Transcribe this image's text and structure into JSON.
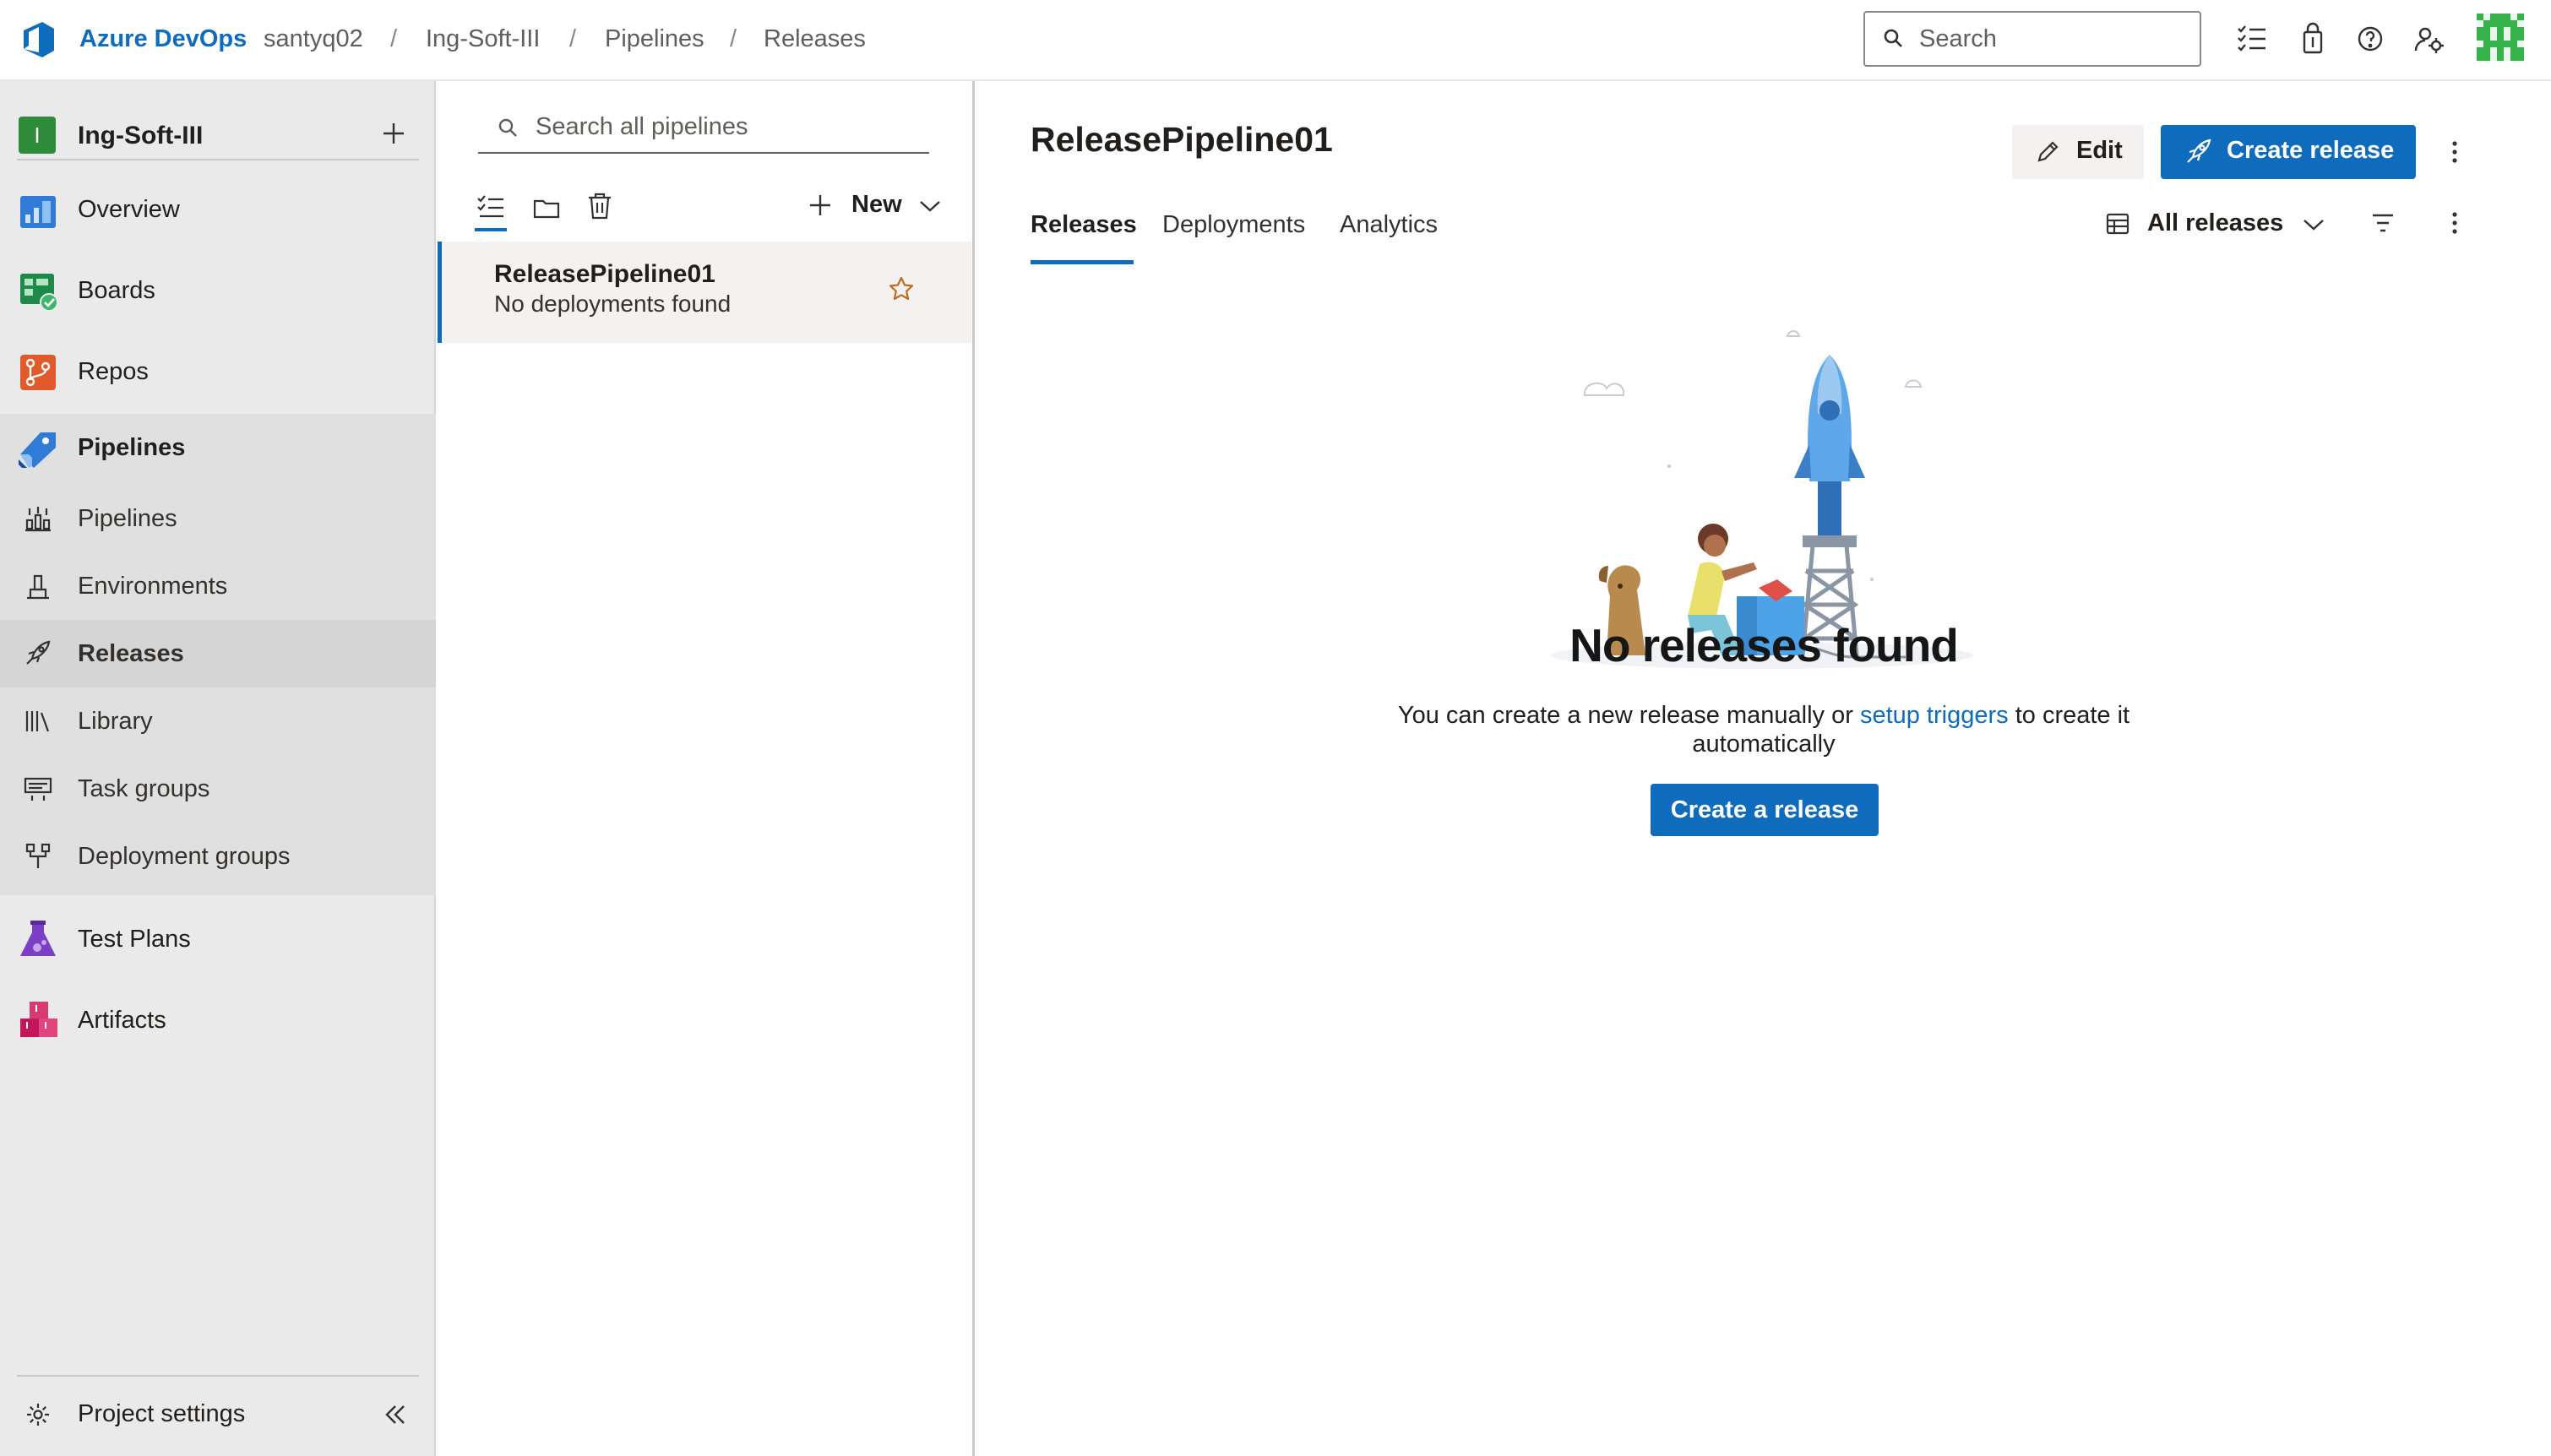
{
  "topbar": {
    "brand": "Azure DevOps",
    "breadcrumbs": [
      "santyq02",
      "Ing-Soft-III",
      "Pipelines",
      "Releases"
    ],
    "separator": "/",
    "search_placeholder": "Search"
  },
  "project": {
    "initial": "I",
    "name": "Ing-Soft-III"
  },
  "nav": {
    "items": [
      {
        "label": "Overview",
        "icon": "overview-icon"
      },
      {
        "label": "Boards",
        "icon": "boards-icon"
      },
      {
        "label": "Repos",
        "icon": "repos-icon"
      },
      {
        "label": "Pipelines",
        "icon": "pipelines-icon"
      },
      {
        "label": "Test Plans",
        "icon": "test-plans-icon"
      },
      {
        "label": "Artifacts",
        "icon": "artifacts-icon"
      }
    ],
    "pipelines_sub": [
      {
        "label": "Pipelines",
        "icon": "pipelines-sub-icon"
      },
      {
        "label": "Environments",
        "icon": "environments-icon"
      },
      {
        "label": "Releases",
        "icon": "releases-icon"
      },
      {
        "label": "Library",
        "icon": "library-icon"
      },
      {
        "label": "Task groups",
        "icon": "task-groups-icon"
      },
      {
        "label": "Deployment groups",
        "icon": "deployment-groups-icon"
      }
    ],
    "project_settings": "Project settings"
  },
  "list": {
    "search_placeholder": "Search all pipelines",
    "new_label": "New",
    "pipelines": [
      {
        "name": "ReleasePipeline01",
        "status": "No deployments found"
      }
    ]
  },
  "main": {
    "title": "ReleasePipeline01",
    "edit_label": "Edit",
    "create_release_label": "Create release",
    "tabs": [
      "Releases",
      "Deployments",
      "Analytics"
    ],
    "view_filter": "All releases",
    "empty_title": "No releases found",
    "empty_text_before": "You can create a new release manually or ",
    "empty_link": "setup triggers",
    "empty_text_after": " to create it",
    "empty_text_line2": "automatically",
    "create_a_release_label": "Create a release"
  },
  "colors": {
    "accent": "#0f6cbd",
    "nav_bg": "#eaeaea",
    "selected_bg": "#d5d5d5"
  }
}
